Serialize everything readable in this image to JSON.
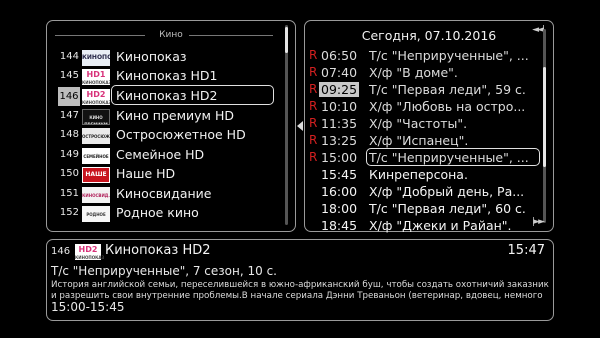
{
  "channel_list": {
    "category": "Кино",
    "items": [
      {
        "number": "144",
        "name": "Кинопоказ",
        "logo": "КИНОПОКАЗ"
      },
      {
        "number": "145",
        "name": "Кинопоказ HD1",
        "logo": "HD1"
      },
      {
        "number": "146",
        "name": "Кинопоказ HD2",
        "logo": "HD2"
      },
      {
        "number": "147",
        "name": "Кино премиум HD",
        "logo": "КИНО ПРЕМИУМ"
      },
      {
        "number": "148",
        "name": "Остросюжетное HD",
        "logo": "ОСТРОСЮЖ."
      },
      {
        "number": "149",
        "name": "Семейное HD",
        "logo": "СЕМЕЙНОЕ"
      },
      {
        "number": "150",
        "name": "Наше HD",
        "logo": "НАШЕ"
      },
      {
        "number": "151",
        "name": "Киносвидание",
        "logo": "КИНОСВИД."
      },
      {
        "number": "152",
        "name": "Родное кино",
        "logo": "РОДНОЕ"
      }
    ]
  },
  "epg": {
    "date": "Сегодня, 07.10.2016",
    "items": [
      {
        "mark": "R",
        "time": "06:50",
        "title": "Т/с \"Неприрученные\", ..."
      },
      {
        "mark": "R",
        "time": "07:40",
        "title": "Х/ф \"В доме\"."
      },
      {
        "mark": "R",
        "time": "09:25",
        "title": "Т/с \"Первая леди\", 59 с."
      },
      {
        "mark": "R",
        "time": "10:10",
        "title": "Х/ф \"Любовь на остро..."
      },
      {
        "mark": "R",
        "time": "11:35",
        "title": "Х/ф \"Частоты\"."
      },
      {
        "mark": "R",
        "time": "13:25",
        "title": "Х/ф \"Испанец\"."
      },
      {
        "mark": "R",
        "time": "15:00",
        "title": "Т/с \"Неприрученные\", ..."
      },
      {
        "mark": "",
        "time": "15:45",
        "title": "Кинреперсона."
      },
      {
        "mark": "",
        "time": "16:00",
        "title": "Х/ф \"Добрый день, Ра..."
      },
      {
        "mark": "",
        "time": "18:00",
        "title": "Т/с \"Первая леди\", 60 с."
      },
      {
        "mark": "",
        "time": "18:45",
        "title": "Х/ф \"Джеки и Райан\"."
      }
    ]
  },
  "info": {
    "number": "146",
    "logo": "HD2",
    "channel_name": "Кинопоказ HD2",
    "clock": "15:47",
    "program": "Т/с \"Неприрученные\", 7 сезон, 10 с.",
    "description": "История английской семьи, переселившейся в южно-африканский буш, чтобы создать охотничий заказник и разрешить свои внутренние проблемы.В начале сериала Дэнни Треваньон (ветеринар, вдовец, немного",
    "time_range": "15:00-15:45"
  },
  "icons": {
    "panel_switch": "arrow-left-icon",
    "prev_day": "skip-back-icon",
    "next_day": "skip-forward-icon"
  }
}
